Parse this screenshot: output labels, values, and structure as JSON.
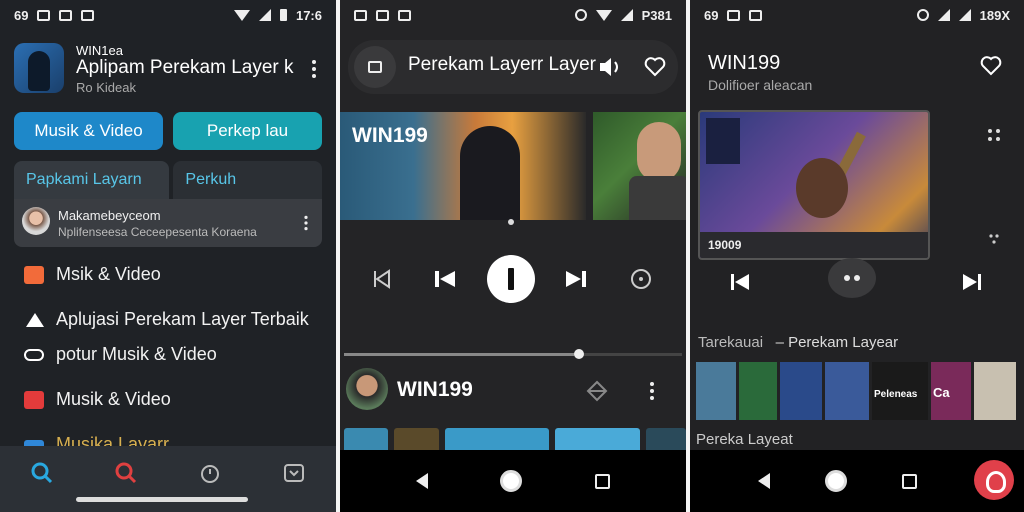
{
  "colors": {
    "accent_blue": "#1e88c9",
    "accent_teal": "#18a2b0",
    "tab_text": "#58c6e8",
    "fab_red": "#e0404a"
  },
  "phone1": {
    "status": {
      "time_left": "69",
      "time_right": "17:6"
    },
    "header": {
      "small_name": "WIN1ea",
      "app_name": "Aplipam Perekam Layer k",
      "subtitle": "Ro Kideak"
    },
    "buttons": {
      "primary": "Musik & Video",
      "secondary": "Perkep lau"
    },
    "tabs": [
      {
        "label": "Papkami Layarn"
      },
      {
        "label": "Perkuh"
      }
    ],
    "card": {
      "title": "Makamebeyceom",
      "subtitle": "Nplifenseesa Ceceepesenta Koraena"
    },
    "menu": [
      {
        "label": "Msik & Video",
        "icon": "video-icon",
        "color": "#f26b3a"
      },
      {
        "label": "Aplujasi Perekam Layer Terbaik",
        "icon": "bookmark-icon",
        "color": "#ffffff"
      },
      {
        "label": "potur Musik & Video",
        "icon": "sliders-icon",
        "color": "#ffffff"
      },
      {
        "label": "Musik & Video",
        "icon": "record-icon",
        "color": "#e33b3b"
      },
      {
        "label": "Musika Layarr",
        "icon": "layers-icon",
        "color": "#2f87d8"
      }
    ],
    "nav": [
      {
        "icon": "discover-icon"
      },
      {
        "icon": "search-icon"
      },
      {
        "icon": "timer-icon"
      },
      {
        "icon": "download-icon"
      }
    ]
  },
  "phone2": {
    "status": {
      "time_right": "P381"
    },
    "top": {
      "title": "Perekam Layerr Layer"
    },
    "thumb": {
      "label": "WIN199"
    },
    "row": {
      "title": "WIN199"
    }
  },
  "phone3": {
    "status": {
      "time_left": "69",
      "time_right": "189X"
    },
    "title": "WIN199",
    "subtitle": "Dolifioer aleacan",
    "video": {
      "time": "19009"
    },
    "section": {
      "left": "Tarekauai",
      "right": "– Perekam Layear"
    },
    "strip_labels": {
      "a": "Peleneas",
      "b": "Ca"
    },
    "footer": "Pereka Layeat"
  }
}
